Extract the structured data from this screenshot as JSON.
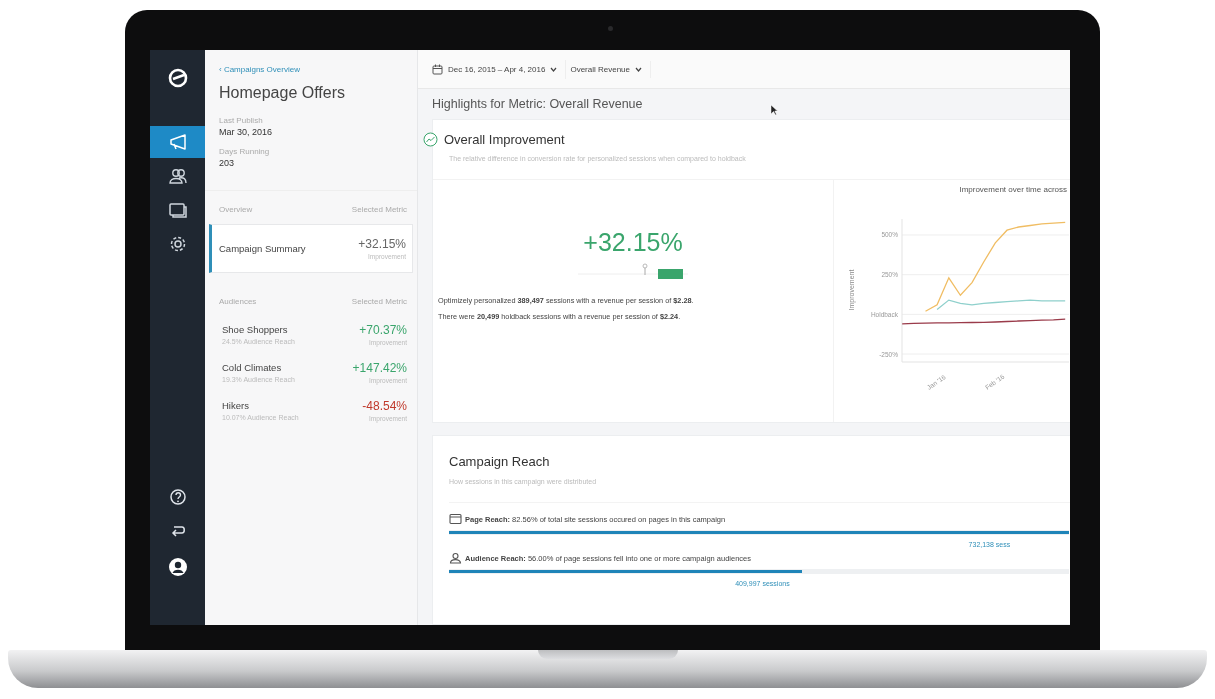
{
  "nav_items": [
    {
      "kind": "megaphone",
      "selected": true
    },
    {
      "kind": "people",
      "selected": false
    },
    {
      "kind": "screens",
      "selected": false
    },
    {
      "kind": "gear",
      "selected": false
    }
  ],
  "nav_bottom": [
    {
      "kind": "help"
    },
    {
      "kind": "exit"
    },
    {
      "kind": "avatar"
    }
  ],
  "panel": {
    "back_link": "‹ Campaigns Overview",
    "title": "Homepage Offers",
    "facts": [
      {
        "label": "Last Publish",
        "value": "Mar 30, 2016"
      },
      {
        "label": "Days Running",
        "value": "203"
      }
    ],
    "groups": [
      {
        "heading": "Overview",
        "metric_heading": "Selected Metric",
        "items": [
          {
            "name": "Campaign Summary",
            "value": "+32.15%",
            "caption": "Improvement",
            "color": "#666666",
            "selected": true
          }
        ]
      },
      {
        "heading": "Audiences",
        "metric_heading": "Selected Metric",
        "items": [
          {
            "name": "Shoe Shoppers",
            "reach": "24.5% Audience Reach",
            "value": "+70.37%",
            "caption": "Improvement",
            "color": "#3aa56c",
            "selected": false
          },
          {
            "name": "Cold Climates",
            "reach": "19.3% Audience Reach",
            "value": "+147.42%",
            "caption": "Improvement",
            "color": "#3aa56c",
            "selected": false
          },
          {
            "name": "Hikers",
            "reach": "10.07% Audience Reach",
            "value": "-48.54%",
            "caption": "Improvement",
            "color": "#c0392b",
            "selected": false
          }
        ]
      }
    ]
  },
  "toolbar": {
    "date_range": "Dec 16, 2015 – Apr 4, 2016",
    "metric": "Overall Revenue"
  },
  "highlights_title": "Highlights for Metric: Overall Revenue",
  "improvement_card": {
    "title": "Overall Improvement",
    "subtitle": "The relative difference in conversion rate for personalized sessions when compared to holdback",
    "value": "+32.15%",
    "summary": [
      "Optimizely personalized **389,497** sessions with a revenue per session of **$2.28**.",
      "There were **20,499** holdback sessions with a revenue per session of **$2.24**."
    ],
    "chart_data": {
      "type": "line",
      "title": "Improvement over time across",
      "ylabel": "Improvement",
      "categories": [
        null,
        null,
        null,
        "Jan '16",
        null,
        null,
        null,
        null,
        "Feb '16",
        null,
        null,
        null,
        null,
        null,
        null
      ],
      "ylim": [
        -300,
        600
      ],
      "grid": true,
      "yticks": [
        {
          "value": 500,
          "label": "500%"
        },
        {
          "value": 250,
          "label": "250%"
        },
        {
          "value": 0,
          "label": "Holdback"
        },
        {
          "value": -250,
          "label": "-250%"
        }
      ],
      "series": [
        {
          "color": "#f0bd63",
          "values": [
            null,
            null,
            20,
            60,
            230,
            120,
            200,
            330,
            450,
            530,
            550,
            560,
            570,
            575,
            580
          ]
        },
        {
          "color": "#8fd0cc",
          "values": [
            null,
            null,
            null,
            30,
            90,
            70,
            60,
            70,
            75,
            80,
            85,
            90,
            85,
            85,
            85
          ]
        },
        {
          "color": "#9a3b4a",
          "values": [
            -60,
            -57,
            -55,
            -54,
            -53,
            -52,
            -51,
            -50,
            -48,
            -45,
            -42,
            -40,
            -37,
            -34,
            -30
          ]
        }
      ]
    }
  },
  "reach_card": {
    "title": "Campaign Reach",
    "subtitle": "How sessions in this campaign were distributed",
    "rows": [
      {
        "kind": "page",
        "text": "**Page Reach:** 82.56% of total site sessions occured on pages in this campaign",
        "level": 1,
        "count": "732,138 sess"
      },
      {
        "kind": "audience",
        "text": "**Audience Reach:** 56.00% of page sessions fell into one or more campaign audiences",
        "level": 0.57,
        "count": "409,997 sessions"
      }
    ]
  }
}
